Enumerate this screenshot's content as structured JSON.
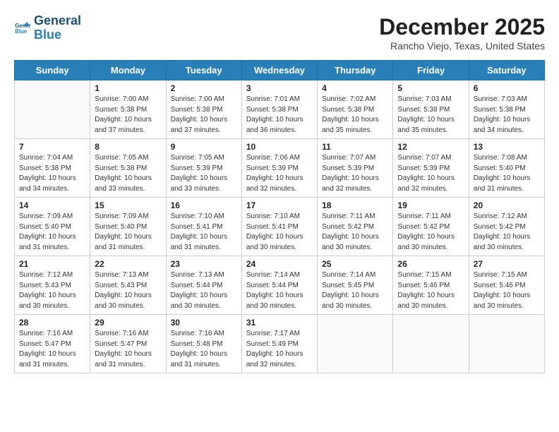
{
  "header": {
    "logo_line1": "General",
    "logo_line2": "Blue",
    "title": "December 2025",
    "subtitle": "Rancho Viejo, Texas, United States"
  },
  "days_of_week": [
    "Sunday",
    "Monday",
    "Tuesday",
    "Wednesday",
    "Thursday",
    "Friday",
    "Saturday"
  ],
  "weeks": [
    [
      {
        "day": "",
        "info": ""
      },
      {
        "day": "1",
        "info": "Sunrise: 7:00 AM\nSunset: 5:38 PM\nDaylight: 10 hours\nand 37 minutes."
      },
      {
        "day": "2",
        "info": "Sunrise: 7:00 AM\nSunset: 5:38 PM\nDaylight: 10 hours\nand 37 minutes."
      },
      {
        "day": "3",
        "info": "Sunrise: 7:01 AM\nSunset: 5:38 PM\nDaylight: 10 hours\nand 36 minutes."
      },
      {
        "day": "4",
        "info": "Sunrise: 7:02 AM\nSunset: 5:38 PM\nDaylight: 10 hours\nand 35 minutes."
      },
      {
        "day": "5",
        "info": "Sunrise: 7:03 AM\nSunset: 5:38 PM\nDaylight: 10 hours\nand 35 minutes."
      },
      {
        "day": "6",
        "info": "Sunrise: 7:03 AM\nSunset: 5:38 PM\nDaylight: 10 hours\nand 34 minutes."
      }
    ],
    [
      {
        "day": "7",
        "info": "Sunrise: 7:04 AM\nSunset: 5:38 PM\nDaylight: 10 hours\nand 34 minutes."
      },
      {
        "day": "8",
        "info": "Sunrise: 7:05 AM\nSunset: 5:38 PM\nDaylight: 10 hours\nand 33 minutes."
      },
      {
        "day": "9",
        "info": "Sunrise: 7:05 AM\nSunset: 5:39 PM\nDaylight: 10 hours\nand 33 minutes."
      },
      {
        "day": "10",
        "info": "Sunrise: 7:06 AM\nSunset: 5:39 PM\nDaylight: 10 hours\nand 32 minutes."
      },
      {
        "day": "11",
        "info": "Sunrise: 7:07 AM\nSunset: 5:39 PM\nDaylight: 10 hours\nand 32 minutes."
      },
      {
        "day": "12",
        "info": "Sunrise: 7:07 AM\nSunset: 5:39 PM\nDaylight: 10 hours\nand 32 minutes."
      },
      {
        "day": "13",
        "info": "Sunrise: 7:08 AM\nSunset: 5:40 PM\nDaylight: 10 hours\nand 31 minutes."
      }
    ],
    [
      {
        "day": "14",
        "info": "Sunrise: 7:09 AM\nSunset: 5:40 PM\nDaylight: 10 hours\nand 31 minutes."
      },
      {
        "day": "15",
        "info": "Sunrise: 7:09 AM\nSunset: 5:40 PM\nDaylight: 10 hours\nand 31 minutes."
      },
      {
        "day": "16",
        "info": "Sunrise: 7:10 AM\nSunset: 5:41 PM\nDaylight: 10 hours\nand 31 minutes."
      },
      {
        "day": "17",
        "info": "Sunrise: 7:10 AM\nSunset: 5:41 PM\nDaylight: 10 hours\nand 30 minutes."
      },
      {
        "day": "18",
        "info": "Sunrise: 7:11 AM\nSunset: 5:42 PM\nDaylight: 10 hours\nand 30 minutes."
      },
      {
        "day": "19",
        "info": "Sunrise: 7:11 AM\nSunset: 5:42 PM\nDaylight: 10 hours\nand 30 minutes."
      },
      {
        "day": "20",
        "info": "Sunrise: 7:12 AM\nSunset: 5:42 PM\nDaylight: 10 hours\nand 30 minutes."
      }
    ],
    [
      {
        "day": "21",
        "info": "Sunrise: 7:12 AM\nSunset: 5:43 PM\nDaylight: 10 hours\nand 30 minutes."
      },
      {
        "day": "22",
        "info": "Sunrise: 7:13 AM\nSunset: 5:43 PM\nDaylight: 10 hours\nand 30 minutes."
      },
      {
        "day": "23",
        "info": "Sunrise: 7:13 AM\nSunset: 5:44 PM\nDaylight: 10 hours\nand 30 minutes."
      },
      {
        "day": "24",
        "info": "Sunrise: 7:14 AM\nSunset: 5:44 PM\nDaylight: 10 hours\nand 30 minutes."
      },
      {
        "day": "25",
        "info": "Sunrise: 7:14 AM\nSunset: 5:45 PM\nDaylight: 10 hours\nand 30 minutes."
      },
      {
        "day": "26",
        "info": "Sunrise: 7:15 AM\nSunset: 5:46 PM\nDaylight: 10 hours\nand 30 minutes."
      },
      {
        "day": "27",
        "info": "Sunrise: 7:15 AM\nSunset: 5:46 PM\nDaylight: 10 hours\nand 30 minutes."
      }
    ],
    [
      {
        "day": "28",
        "info": "Sunrise: 7:16 AM\nSunset: 5:47 PM\nDaylight: 10 hours\nand 31 minutes."
      },
      {
        "day": "29",
        "info": "Sunrise: 7:16 AM\nSunset: 5:47 PM\nDaylight: 10 hours\nand 31 minutes."
      },
      {
        "day": "30",
        "info": "Sunrise: 7:16 AM\nSunset: 5:48 PM\nDaylight: 10 hours\nand 31 minutes."
      },
      {
        "day": "31",
        "info": "Sunrise: 7:17 AM\nSunset: 5:49 PM\nDaylight: 10 hours\nand 32 minutes."
      },
      {
        "day": "",
        "info": ""
      },
      {
        "day": "",
        "info": ""
      },
      {
        "day": "",
        "info": ""
      }
    ]
  ]
}
